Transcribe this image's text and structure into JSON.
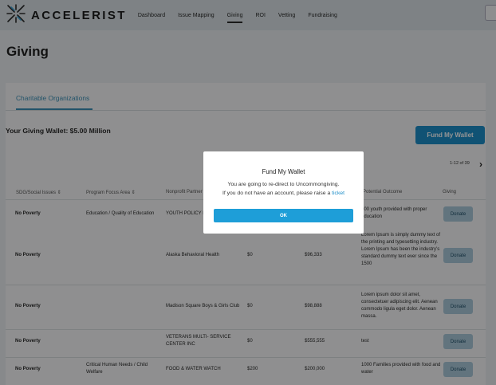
{
  "app": {
    "logo_text": "ACCELERIST"
  },
  "nav": {
    "items": [
      "Dashboard",
      "Issue Mapping",
      "Giving",
      "ROI",
      "Vetting",
      "Fundraising"
    ],
    "active": "Giving"
  },
  "page": {
    "title": "Giving"
  },
  "tabs": {
    "active_label": "Charitable Organizations"
  },
  "wallet": {
    "label": "Your Giving Wallet: $5.00 Million",
    "fund_button": "Fund My Wallet"
  },
  "pagination": {
    "range": "1-12 of 39",
    "next_icon": "chevron-right-icon"
  },
  "table": {
    "headers": [
      "SDG/Social Issues",
      "Program Focus Area",
      "Nonprofit Partner",
      "",
      "",
      "Potential Outcome",
      "Giving"
    ],
    "sort_icon": "sort-arrows-icon",
    "rows": [
      {
        "issue": "No Poverty",
        "focus": "Education / Quality of Education",
        "partner": "YOUTH POLICY I",
        "amount1": "",
        "amount2": "",
        "outcome": "500 youth provided with proper education",
        "action": "Donate"
      },
      {
        "issue": "No Poverty",
        "focus": "",
        "partner": "Alaska Behavioral Health",
        "amount1": "$0",
        "amount2": "$96,333",
        "outcome": "Lorem Ipsum is simply dummy text of the printing and typesetting industry. Lorem Ipsum has been the industry's standard dummy text ever since the 1500",
        "action": "Donate"
      },
      {
        "issue": "No Poverty",
        "focus": "",
        "partner": "Madison Square Boys & Girls Club",
        "amount1": "$0",
        "amount2": "$98,888",
        "outcome": "Lorem ipsum dolor sit amet, consectetuer adipiscing elit. Aenean commodo ligula eget dolor. Aenean massa.",
        "action": "Donate"
      },
      {
        "issue": "No Poverty",
        "focus": "",
        "partner": "VETERANS MULTI- SERVICE CENTER INC",
        "amount1": "$0",
        "amount2": "$555,555",
        "outcome": "test",
        "action": "Donate"
      },
      {
        "issue": "No Poverty",
        "focus": "Critical Human Needs / Child Welfare",
        "partner": "FOOD & WATER WATCH",
        "amount1": "$200",
        "amount2": "$200,000",
        "outcome": "1000 Families provided with food and water",
        "action": "Donate"
      }
    ]
  },
  "modal": {
    "title": "Fund My Wallet",
    "line1": "You are going to re-direct to Uncommongiving.",
    "line2": "If you do not have an account, please raise a",
    "link": "ticket",
    "ok_label": "OK"
  },
  "colors": {
    "accent": "#1c8dc8",
    "tab_accent": "#3b8fb6",
    "donate_bg": "#aac9da",
    "topbar_bg": "#d9e1e5"
  }
}
